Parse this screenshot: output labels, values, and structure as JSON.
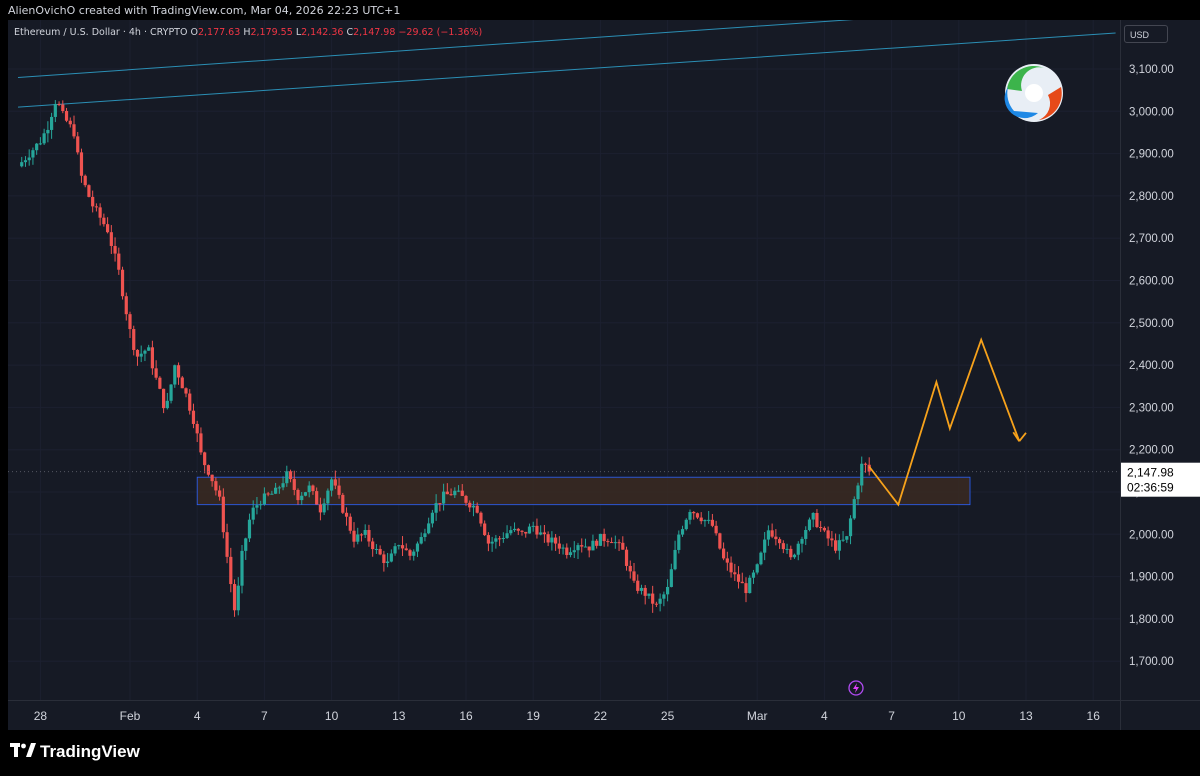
{
  "header": {
    "credit": "AlienOvichO created with TradingView.com, Mar 04, 2026 22:23 UTC+1"
  },
  "legend": {
    "symbol": "Ethereum / U.S. Dollar · 4h · CRYPTO",
    "o_label": "O",
    "o": "2,177.63",
    "h_label": "H",
    "h": "2,179.55",
    "l_label": "L",
    "l": "2,142.36",
    "c_label": "C",
    "c": "2,147.98",
    "change": "−29.62 (−1.36%)"
  },
  "price_scale": {
    "currency": "USD",
    "last_price": "2,147.98",
    "countdown": "02:36:59"
  },
  "footer": {
    "brand": "TradingView"
  },
  "icons": [
    "tradingview-logo-icon",
    "author-logo-icon",
    "lightning-icon"
  ],
  "colors": {
    "background": "#161a25",
    "up": "#26a69a",
    "down": "#ef5350",
    "projection": "#f7a21b",
    "zone_fill": "#3a2a22",
    "zone_border": "#2962ff",
    "trendline": "#2b8fb5"
  },
  "chart_data": {
    "type": "candlestick",
    "title": "Ethereum / U.S. Dollar · 4h · CRYPTO",
    "ylim": [
      1620,
      3170
    ],
    "y_ticks": [
      "3,100.00",
      "3,000.00",
      "2,900.00",
      "2,800.00",
      "2,700.00",
      "2,600.00",
      "2,500.00",
      "2,400.00",
      "2,300.00",
      "2,200.00",
      "2,100.00",
      "2,000.00",
      "1,900.00",
      "1,800.00",
      "1,700.00"
    ],
    "y_tick_values": [
      3100,
      3000,
      2900,
      2800,
      2700,
      2600,
      2500,
      2400,
      2300,
      2200,
      2100,
      2000,
      1900,
      1800,
      1700
    ],
    "x_ticks": [
      "28",
      "Feb",
      "4",
      "7",
      "10",
      "13",
      "16",
      "19",
      "22",
      "25",
      "Mar",
      "4",
      "7",
      "10",
      "13",
      "16"
    ],
    "x_tick_days": [
      -4,
      0,
      3,
      6,
      9,
      12,
      15,
      18,
      21,
      24,
      28,
      31,
      34,
      37,
      40,
      43
    ],
    "x_label_note": "days relative to Feb 1",
    "price_path": [
      [
        -5.0,
        2870
      ],
      [
        -4.0,
        2930
      ],
      [
        -3.7,
        2960
      ],
      [
        -3.3,
        3030
      ],
      [
        -3.0,
        2990
      ],
      [
        -2.5,
        2950
      ],
      [
        -2.2,
        2850
      ],
      [
        -1.7,
        2780
      ],
      [
        -1.0,
        2720
      ],
      [
        -0.5,
        2620
      ],
      [
        0.0,
        2480
      ],
      [
        0.3,
        2420
      ],
      [
        0.8,
        2440
      ],
      [
        1.2,
        2360
      ],
      [
        1.6,
        2290
      ],
      [
        2.0,
        2400
      ],
      [
        2.5,
        2330
      ],
      [
        2.9,
        2260
      ],
      [
        3.2,
        2180
      ],
      [
        3.6,
        2140
      ],
      [
        4.0,
        2080
      ],
      [
        4.4,
        1920
      ],
      [
        4.7,
        1810
      ],
      [
        5.0,
        1950
      ],
      [
        5.4,
        2050
      ],
      [
        5.8,
        2080
      ],
      [
        6.5,
        2100
      ],
      [
        7.0,
        2140
      ],
      [
        7.5,
        2090
      ],
      [
        8.0,
        2110
      ],
      [
        8.5,
        2060
      ],
      [
        9.0,
        2130
      ],
      [
        9.5,
        2060
      ],
      [
        10.0,
        1990
      ],
      [
        10.5,
        2000
      ],
      [
        11.0,
        1960
      ],
      [
        11.5,
        1930
      ],
      [
        12.0,
        1980
      ],
      [
        12.5,
        1950
      ],
      [
        13.0,
        1990
      ],
      [
        13.5,
        2060
      ],
      [
        14.0,
        2090
      ],
      [
        14.5,
        2100
      ],
      [
        15.0,
        2080
      ],
      [
        15.5,
        2060
      ],
      [
        16.0,
        1980
      ],
      [
        16.5,
        1990
      ],
      [
        17.0,
        2010
      ],
      [
        17.5,
        2000
      ],
      [
        18.0,
        2020
      ],
      [
        18.5,
        1990
      ],
      [
        19.0,
        1980
      ],
      [
        19.5,
        1960
      ],
      [
        20.0,
        1980
      ],
      [
        20.5,
        1970
      ],
      [
        21.0,
        1990
      ],
      [
        21.5,
        1990
      ],
      [
        22.0,
        1960
      ],
      [
        22.5,
        1880
      ],
      [
        23.0,
        1860
      ],
      [
        23.5,
        1830
      ],
      [
        24.0,
        1870
      ],
      [
        24.5,
        2000
      ],
      [
        25.0,
        2060
      ],
      [
        25.5,
        2040
      ],
      [
        26.0,
        2020
      ],
      [
        26.5,
        1940
      ],
      [
        27.0,
        1900
      ],
      [
        27.5,
        1870
      ],
      [
        28.0,
        1920
      ],
      [
        28.5,
        2010
      ],
      [
        29.0,
        1990
      ],
      [
        29.5,
        1940
      ],
      [
        30.0,
        2000
      ],
      [
        30.5,
        2040
      ],
      [
        31.0,
        2000
      ],
      [
        31.5,
        1970
      ],
      [
        32.0,
        1990
      ],
      [
        32.4,
        2100
      ],
      [
        32.7,
        2170
      ],
      [
        33.0,
        2148
      ]
    ],
    "resistance_zone": {
      "from_day": 3.0,
      "to_day": 37.5,
      "low": 2070,
      "high": 2135
    },
    "last_price": 2147.98,
    "projection": [
      [
        33.0,
        2160
      ],
      [
        34.3,
        2070
      ],
      [
        36.0,
        2360
      ],
      [
        36.6,
        2250
      ],
      [
        38.0,
        2460
      ],
      [
        39.7,
        2220
      ]
    ],
    "projection_arrow_tip": [
      40.0,
      2240
    ],
    "trendlines": [
      {
        "from": [
          -5,
          3010
        ],
        "to": [
          44,
          3185
        ]
      },
      {
        "from": [
          -5,
          3080
        ],
        "to": [
          44,
          3260
        ]
      }
    ]
  }
}
